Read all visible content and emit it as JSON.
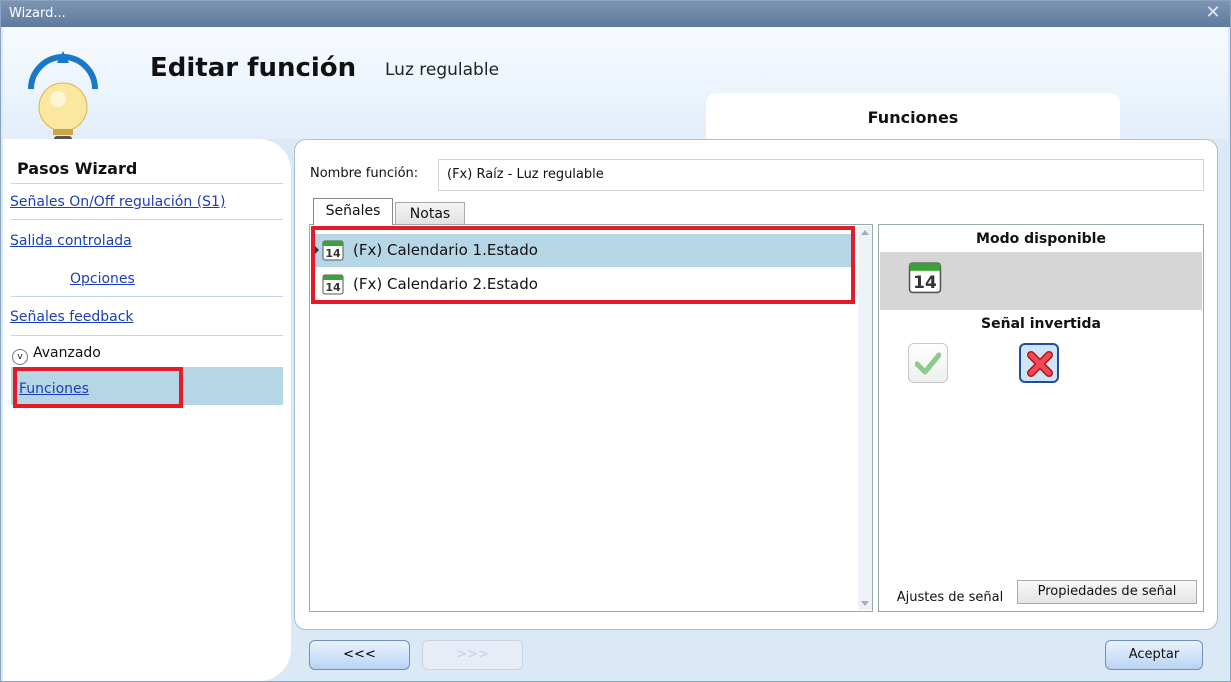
{
  "window": {
    "title": "Wizard...",
    "close_label": "✕"
  },
  "header": {
    "title": "Editar función",
    "subtitle": "Luz regulable",
    "tab_label": "Funciones"
  },
  "sidebar": {
    "title": "Pasos Wizard",
    "items": [
      {
        "label": "Señales On/Off regulación (S1)"
      },
      {
        "label": "Salida controlada"
      },
      {
        "label": "Opciones"
      },
      {
        "label": "Señales feedback"
      },
      {
        "label": "Avanzado"
      },
      {
        "label": "Funciones"
      }
    ]
  },
  "form": {
    "function_name_label": "Nombre función:",
    "function_name_value": "(Fx) Raíz - Luz regulable",
    "tabs": [
      {
        "label": "Señales"
      },
      {
        "label": "Notas"
      }
    ]
  },
  "signals": [
    {
      "icon_text": "14",
      "label": "(Fx) Calendario 1.Estado"
    },
    {
      "icon_text": "14",
      "label": "(Fx) Calendario 2.Estado"
    }
  ],
  "right_panel": {
    "available_mode_title": "Modo disponible",
    "mode_icon_text": "14",
    "inverted_title": "Señal invertida",
    "bottom_tabs": [
      {
        "label": "Ajustes de señal"
      },
      {
        "label": "Propiedades de señal"
      }
    ]
  },
  "footer": {
    "back_label": "<<<",
    "next_label": ">>>",
    "accept_label": "Aceptar"
  },
  "colors": {
    "highlight_red": "#e41c2a",
    "selected_row": "#b6d6e6",
    "link": "#1a3fb8"
  }
}
